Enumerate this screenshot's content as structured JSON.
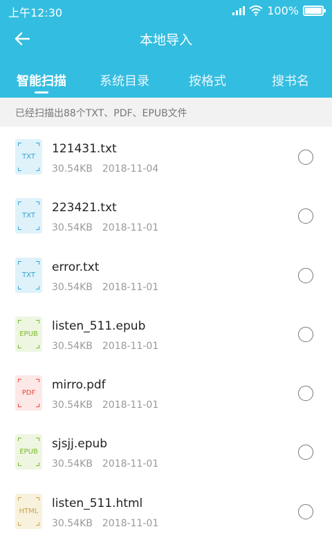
{
  "status_bar": {
    "time": "上午12:30",
    "battery": "100%",
    "battery_level": 1.0
  },
  "header": {
    "title": "本地导入",
    "back_icon": "arrow-left-icon",
    "background": "#33bde0"
  },
  "tabs": [
    {
      "label": "智能扫描",
      "active": true
    },
    {
      "label": "系统目录",
      "active": false
    },
    {
      "label": "按格式",
      "active": false
    },
    {
      "label": "搜书名",
      "active": false
    }
  ],
  "summary": "已经扫描出88个TXT、PDF、EPUB文件",
  "files": [
    {
      "name": "121431.txt",
      "size": "30.54KB",
      "date": "2018-11-04",
      "type": "TXT",
      "icon_color": "#2aa6d6",
      "icon_bg": "#dff2fa"
    },
    {
      "name": "223421.txt",
      "size": "30.54KB",
      "date": "2018-11-01",
      "type": "TXT",
      "icon_color": "#2aa6d6",
      "icon_bg": "#dff2fa"
    },
    {
      "name": "error.txt",
      "size": "30.54KB",
      "date": "2018-11-01",
      "type": "TXT",
      "icon_color": "#2aa6d6",
      "icon_bg": "#dff2fa"
    },
    {
      "name": "listen_511.epub",
      "size": "30.54KB",
      "date": "2018-11-01",
      "type": "EPUB",
      "icon_color": "#7ab828",
      "icon_bg": "#eef6e2"
    },
    {
      "name": "mirro.pdf",
      "size": "30.54KB",
      "date": "2018-11-01",
      "type": "PDF",
      "icon_color": "#e8463c",
      "icon_bg": "#fce8e6"
    },
    {
      "name": "sjsjj.epub",
      "size": "30.54KB",
      "date": "2018-11-01",
      "type": "EPUB",
      "icon_color": "#7ab828",
      "icon_bg": "#eef6e2"
    },
    {
      "name": "listen_511.html",
      "size": "30.54KB",
      "date": "2018-11-01",
      "type": "HTML",
      "icon_color": "#c9a24a",
      "icon_bg": "#f8f1dc"
    }
  ]
}
